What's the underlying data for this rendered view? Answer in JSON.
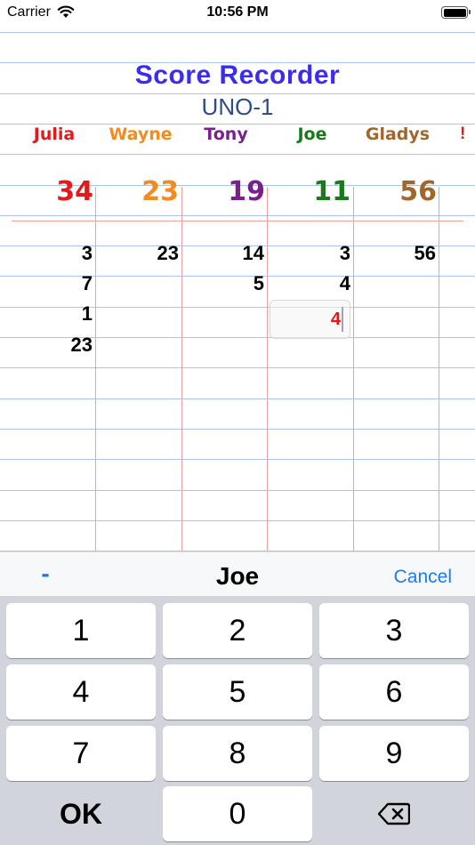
{
  "status_bar": {
    "carrier": "Carrier",
    "time": "10:56 PM"
  },
  "app": {
    "title": "Score Recorder",
    "game": "UNO-1"
  },
  "players": [
    {
      "name": "Julia",
      "color": "#e41a1a",
      "total": "34",
      "scores": [
        "3",
        "7",
        "1",
        "23"
      ]
    },
    {
      "name": "Wayne",
      "color": "#f58a1f",
      "total": "23",
      "scores": [
        "23"
      ]
    },
    {
      "name": "Tony",
      "color": "#7a1f8c",
      "total": "19",
      "scores": [
        "14",
        "5"
      ]
    },
    {
      "name": "Joe",
      "color": "#1a7a1a",
      "total": "11",
      "scores": [
        "3",
        "4"
      ]
    },
    {
      "name": "Gladys",
      "color": "#a0662c",
      "total": "56",
      "scores": [
        "56"
      ]
    }
  ],
  "overflow_indicator": "!",
  "edit": {
    "player": "Joe",
    "value": "4"
  },
  "accessory": {
    "minus_label": "-",
    "player_name": "Joe",
    "cancel_label": "Cancel"
  },
  "keypad": {
    "k1": "1",
    "k2": "2",
    "k3": "3",
    "k4": "4",
    "k5": "5",
    "k6": "6",
    "k7": "7",
    "k8": "8",
    "k9": "9",
    "ok": "OK",
    "k0": "0",
    "backspace_icon": "delete-backward-icon"
  },
  "colors": {
    "title": "#3b2df0",
    "subtitle": "#2e4c8c",
    "accent": "#1a7cf0",
    "rule_blue": "#a9c4ea",
    "rule_red": "#f0a0a0"
  }
}
